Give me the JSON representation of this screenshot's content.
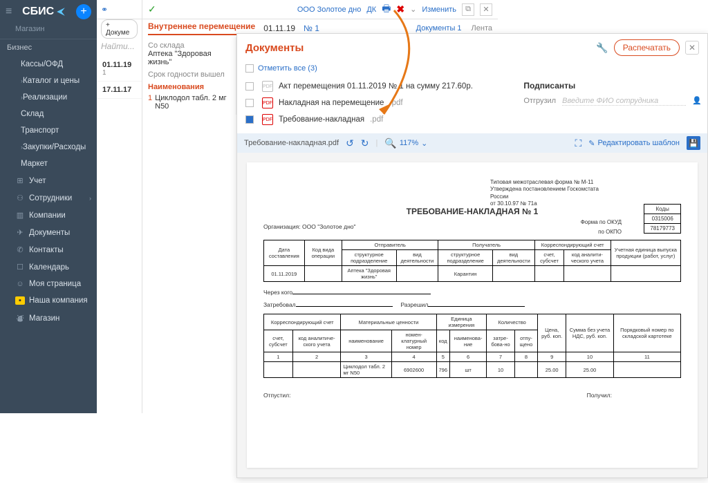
{
  "logo": "СБИС",
  "shop": "Магазин",
  "biz": "Бизнес",
  "nav": {
    "kassy": "Кассы/ОФД",
    "katalog": "Каталог и цены",
    "realiz": "Реализации",
    "sklad": "Склад",
    "transport": "Транспорт",
    "zakupki": "Закупки/Расходы",
    "market": "Маркет",
    "uchet": "Учет",
    "sotrud": "Сотрудники",
    "kompanii": "Компании",
    "dokumenty": "Документы",
    "kontakty": "Контакты",
    "kalendar": "Календарь",
    "moya": "Моя страница",
    "nasha": "Наша компания",
    "magazin": "Магазин"
  },
  "ml": {
    "add": "+ Докуме",
    "search": "Найти...",
    "r1d": "01.11.19",
    "r1n": "1",
    "r2d": "17.11.17"
  },
  "dlg": {
    "org": "ООО Золотое дно",
    "dk": "ДК",
    "change": "Изменить",
    "tab": "Внутреннее перемещение",
    "date": "01.11.19",
    "num": "№ 1",
    "docs": "Документы 1",
    "lenta": "Лента"
  },
  "lp": {
    "from": "Со склада",
    "pharmacy": "Аптека \"Здоровая жизнь\"",
    "srok": "Срок годности вышел",
    "names": "Наименования",
    "n": "1",
    "item": "Циклодол табл. 2 мг N50"
  },
  "pop": {
    "title": "Документы",
    "print": "Распечатать",
    "markall": "Отметить все (3)",
    "d1": "Акт перемещения 01.11.2019 № 1 на сумму 217.60р.",
    "d2": "Накладная на перемещение",
    "d3": "Требование-накладная",
    "ext": ".pdf",
    "signers": "Подписанты",
    "sent": "Отгрузил",
    "fio": "Введите ФИО сотрудника"
  },
  "pv": {
    "file": "Требование-накладная.pdf",
    "zoom": "117%",
    "edit": "Редактировать шаблон"
  },
  "doc": {
    "form1": "Типовая межотраслевая форма № М-11",
    "form2": "Утверждена постановлением Госкомстата России",
    "form3": "от 30.10.97 № 71а",
    "title": "ТРЕБОВАНИЕ-НАКЛАДНАЯ № 1",
    "kody": "Коды",
    "okud_l": "Форма по ОКУД",
    "okud_v": "0315006",
    "okpo_l": "по ОКПО",
    "okpo_v": "78179773",
    "orgl": "Организация:",
    "orgv": "ООО \"Золотое дно\"",
    "t1": {
      "date": "Дата составления",
      "kod": "Код вида операции",
      "otpr": "Отправитель",
      "poluch": "Получатель",
      "korr": "Корреспондирующий счет",
      "uchet": "Учетная единица выпуска продукции (работ, услуг)",
      "struct": "структурное подразделение",
      "vid": "вид деятельности",
      "schet": "счет, субсчет",
      "kodan": "код аналити-ческого учета",
      "v_date": "01.11.2019",
      "v_from": "Аптека \"Здоровая жизнь\"",
      "v_to": "Карантин"
    },
    "cherez": "Через кого",
    "zatreb": "Затребовал",
    "razresh": "Разрешил",
    "t2": {
      "korr": "Корреспондирующий счет",
      "mat": "Материальные ценности",
      "ed": "Единица измерения",
      "kol": "Количество",
      "cena": "Цена, руб. коп.",
      "summa": "Сумма без учета НДС, руб. коп.",
      "por": "Порядковый номер по складской картотеке",
      "schet": "счет, субсчет",
      "kodan": "код аналитиче-ского учета",
      "naim": "наименование",
      "nomen": "номен-клатурный номер",
      "kod": "код",
      "naime": "наименова-ние",
      "zatr": "затре-бова-но",
      "otp": "отпу-щено",
      "c1": "1",
      "c2": "2",
      "c3": "3",
      "c4": "4",
      "c5": "5",
      "c6": "6",
      "c7": "7",
      "c8": "8",
      "c9": "9",
      "c10": "10",
      "c11": "11",
      "r_naim": "Циклодол табл. 2 мг N50",
      "r_nomen": "6902600",
      "r_kod": "796",
      "r_ed": "шт",
      "r_zatr": "10",
      "r_cena": "25.00",
      "r_sum": "25.00"
    },
    "otpustil": "Отпустил:",
    "poluchil": "Получил:"
  }
}
